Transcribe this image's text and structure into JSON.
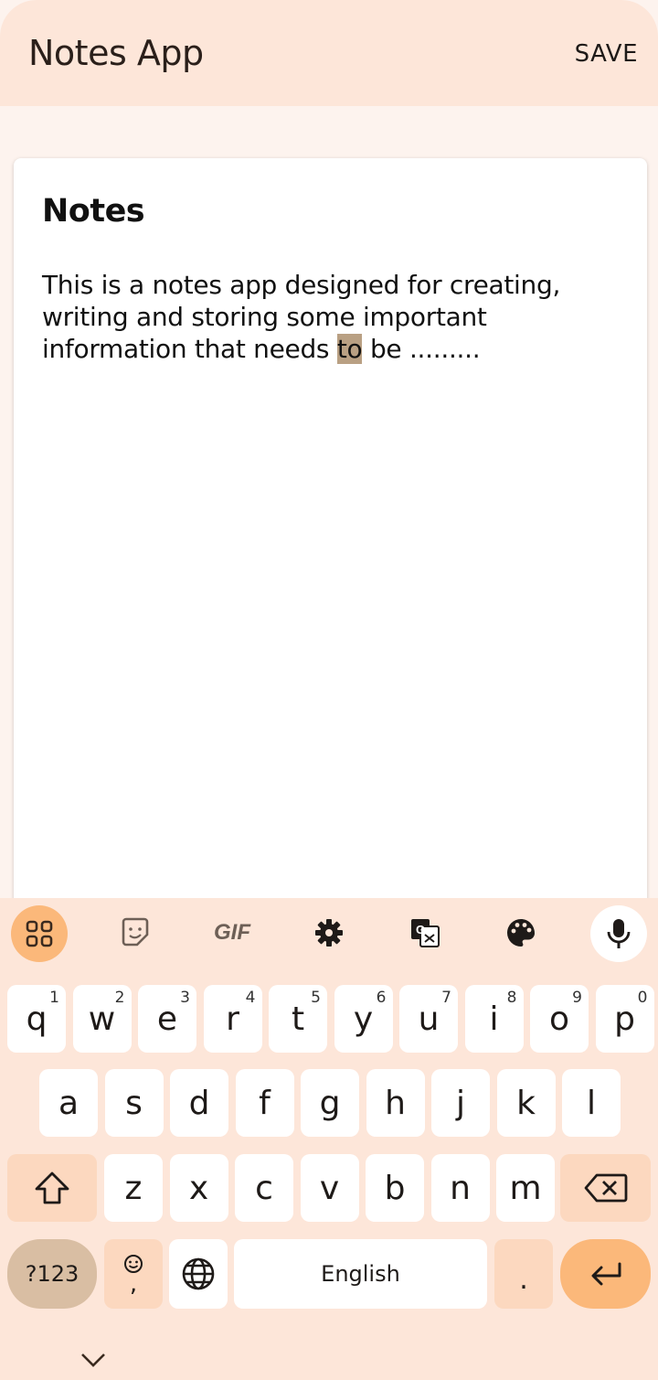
{
  "app_bar": {
    "title": "Notes App",
    "save_label": "SAVE"
  },
  "note": {
    "title": "Notes",
    "body_before": "This is a notes app designed for creating, writing and storing some important information that needs ",
    "body_selected": "to",
    "body_after": " be ........."
  },
  "keyboard": {
    "toolbar": [
      "apps-grid-icon",
      "sticker-icon",
      "GIF",
      "settings-gear-icon",
      "translate-icon",
      "palette-icon",
      "microphone-icon"
    ],
    "gif_label": "GIF",
    "row1": [
      {
        "k": "q",
        "n": "1"
      },
      {
        "k": "w",
        "n": "2"
      },
      {
        "k": "e",
        "n": "3"
      },
      {
        "k": "r",
        "n": "4"
      },
      {
        "k": "t",
        "n": "5"
      },
      {
        "k": "y",
        "n": "6"
      },
      {
        "k": "u",
        "n": "7"
      },
      {
        "k": "i",
        "n": "8"
      },
      {
        "k": "o",
        "n": "9"
      },
      {
        "k": "p",
        "n": "0"
      }
    ],
    "row2": [
      "a",
      "s",
      "d",
      "f",
      "g",
      "h",
      "j",
      "k",
      "l"
    ],
    "row3": [
      "z",
      "x",
      "c",
      "v",
      "b",
      "n",
      "m"
    ],
    "symbols_label": "?123",
    "comma_label": ",",
    "space_label": "English",
    "period_label": "."
  },
  "colors": {
    "app_bar": "#fde6d9",
    "accent": "#fbb87a",
    "selection": "#b9a083"
  }
}
